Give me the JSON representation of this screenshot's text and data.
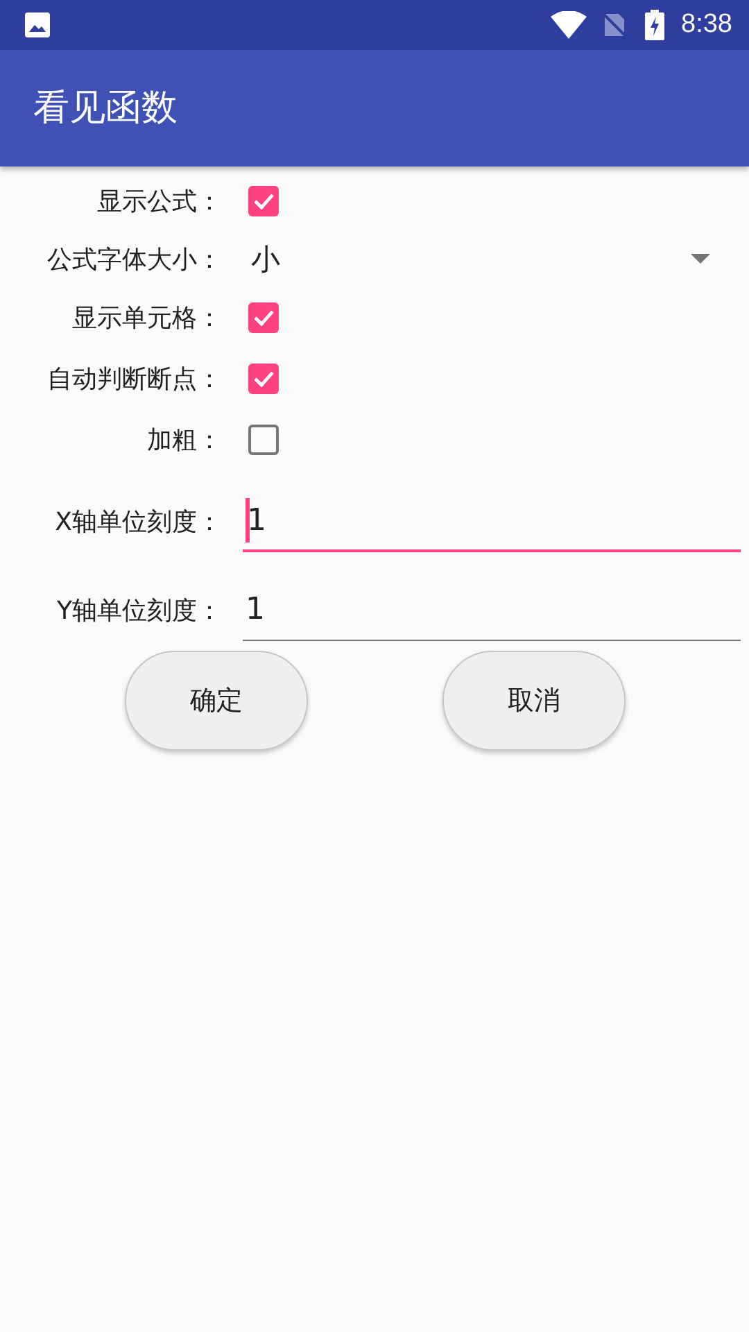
{
  "status_bar": {
    "time": "8:38"
  },
  "app_bar": {
    "title": "看见函数"
  },
  "rows": [
    {
      "kind": "checkbox",
      "label": "显示公式：",
      "checked": true
    },
    {
      "kind": "dropdown",
      "label": "公式字体大小：",
      "value": "小"
    },
    {
      "kind": "checkbox",
      "label": "显示单元格：",
      "checked": true
    },
    {
      "kind": "checkbox",
      "label": "自动判断断点：",
      "checked": true
    },
    {
      "kind": "checkbox",
      "label": "加粗：",
      "checked": false
    },
    {
      "kind": "field",
      "label": "X轴单位刻度：",
      "value": "1",
      "focused": true
    },
    {
      "kind": "field",
      "label": "Y轴单位刻度：",
      "value": "1",
      "focused": false
    }
  ],
  "buttons": [
    "确定",
    "取消"
  ]
}
